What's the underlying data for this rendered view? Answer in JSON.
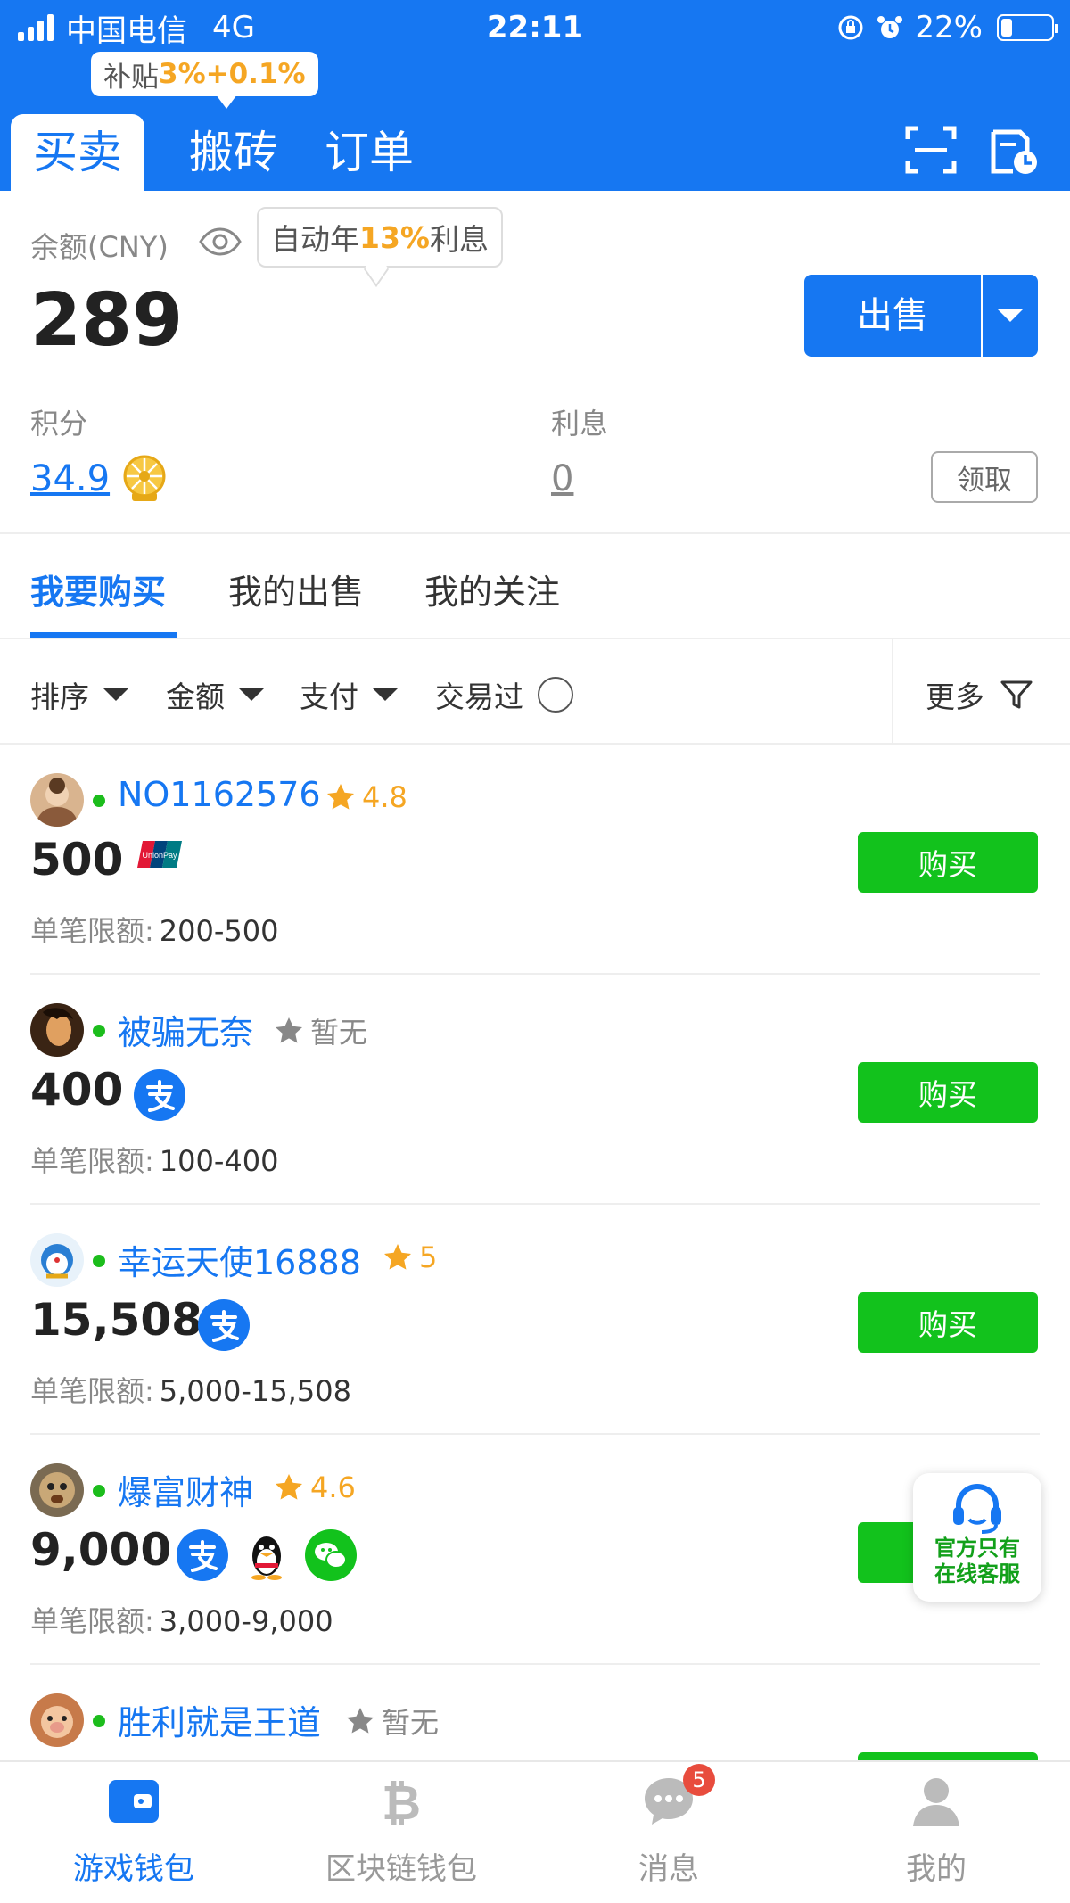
{
  "status_bar": {
    "carrier": "中国电信",
    "network": "4G",
    "time": "22:11",
    "battery": "22%"
  },
  "subsidy": {
    "prefix": "补贴",
    "value": "3%+0.1%"
  },
  "top_tabs": [
    {
      "label": "买卖"
    },
    {
      "label": "搬砖"
    },
    {
      "label": "订单"
    }
  ],
  "balance": {
    "label": "余额(CNY)",
    "interest_tip_prefix": "自动年",
    "interest_tip_value": "13%",
    "interest_tip_suffix": "利息",
    "amount": "289",
    "sell_label": "出售"
  },
  "points": {
    "label": "积分",
    "value": "34.9"
  },
  "interest": {
    "label": "利息",
    "value": "0",
    "claim_label": "领取"
  },
  "sub_tabs": [
    {
      "label": "我要购买"
    },
    {
      "label": "我的出售"
    },
    {
      "label": "我的关注"
    }
  ],
  "filters": {
    "sort": "排序",
    "amount": "金额",
    "payment": "支付",
    "traded": "交易过",
    "more": "更多"
  },
  "listings": [
    {
      "user": "NO1162576",
      "rating": "4.8",
      "amount": "500",
      "limit_label": "单笔限额:",
      "limit": "200-500",
      "buy_label": "购买",
      "payments": [
        "unionpay-icon"
      ]
    },
    {
      "user": "被骗无奈",
      "rating": "暂无",
      "amount": "400",
      "limit_label": "单笔限额:",
      "limit": "100-400",
      "buy_label": "购买",
      "payments": [
        "alipay-icon"
      ]
    },
    {
      "user": "幸运天使16888",
      "rating": "5",
      "amount": "15,508",
      "limit_label": "单笔限额:",
      "limit": "5,000-15,508",
      "buy_label": "购买",
      "payments": [
        "alipay-icon"
      ]
    },
    {
      "user": "爆富财神",
      "rating": "4.6",
      "amount": "9,000",
      "limit_label": "单笔限额:",
      "limit": "3,000-9,000",
      "buy_label": "购买",
      "payments": [
        "alipay-icon",
        "qq-icon",
        "wechat-icon"
      ]
    },
    {
      "user": "胜利就是王道",
      "rating": "暂无"
    }
  ],
  "service": {
    "line1": "官方只有",
    "line2": "在线客服"
  },
  "bottom_nav": [
    {
      "label": "游戏钱包"
    },
    {
      "label": "区块链钱包"
    },
    {
      "label": "消息",
      "badge": "5"
    },
    {
      "label": "我的"
    }
  ],
  "colors": {
    "brand": "#1677f2",
    "buy": "#12c21c",
    "highlight": "#f5a623",
    "online": "#1cbd1c"
  }
}
